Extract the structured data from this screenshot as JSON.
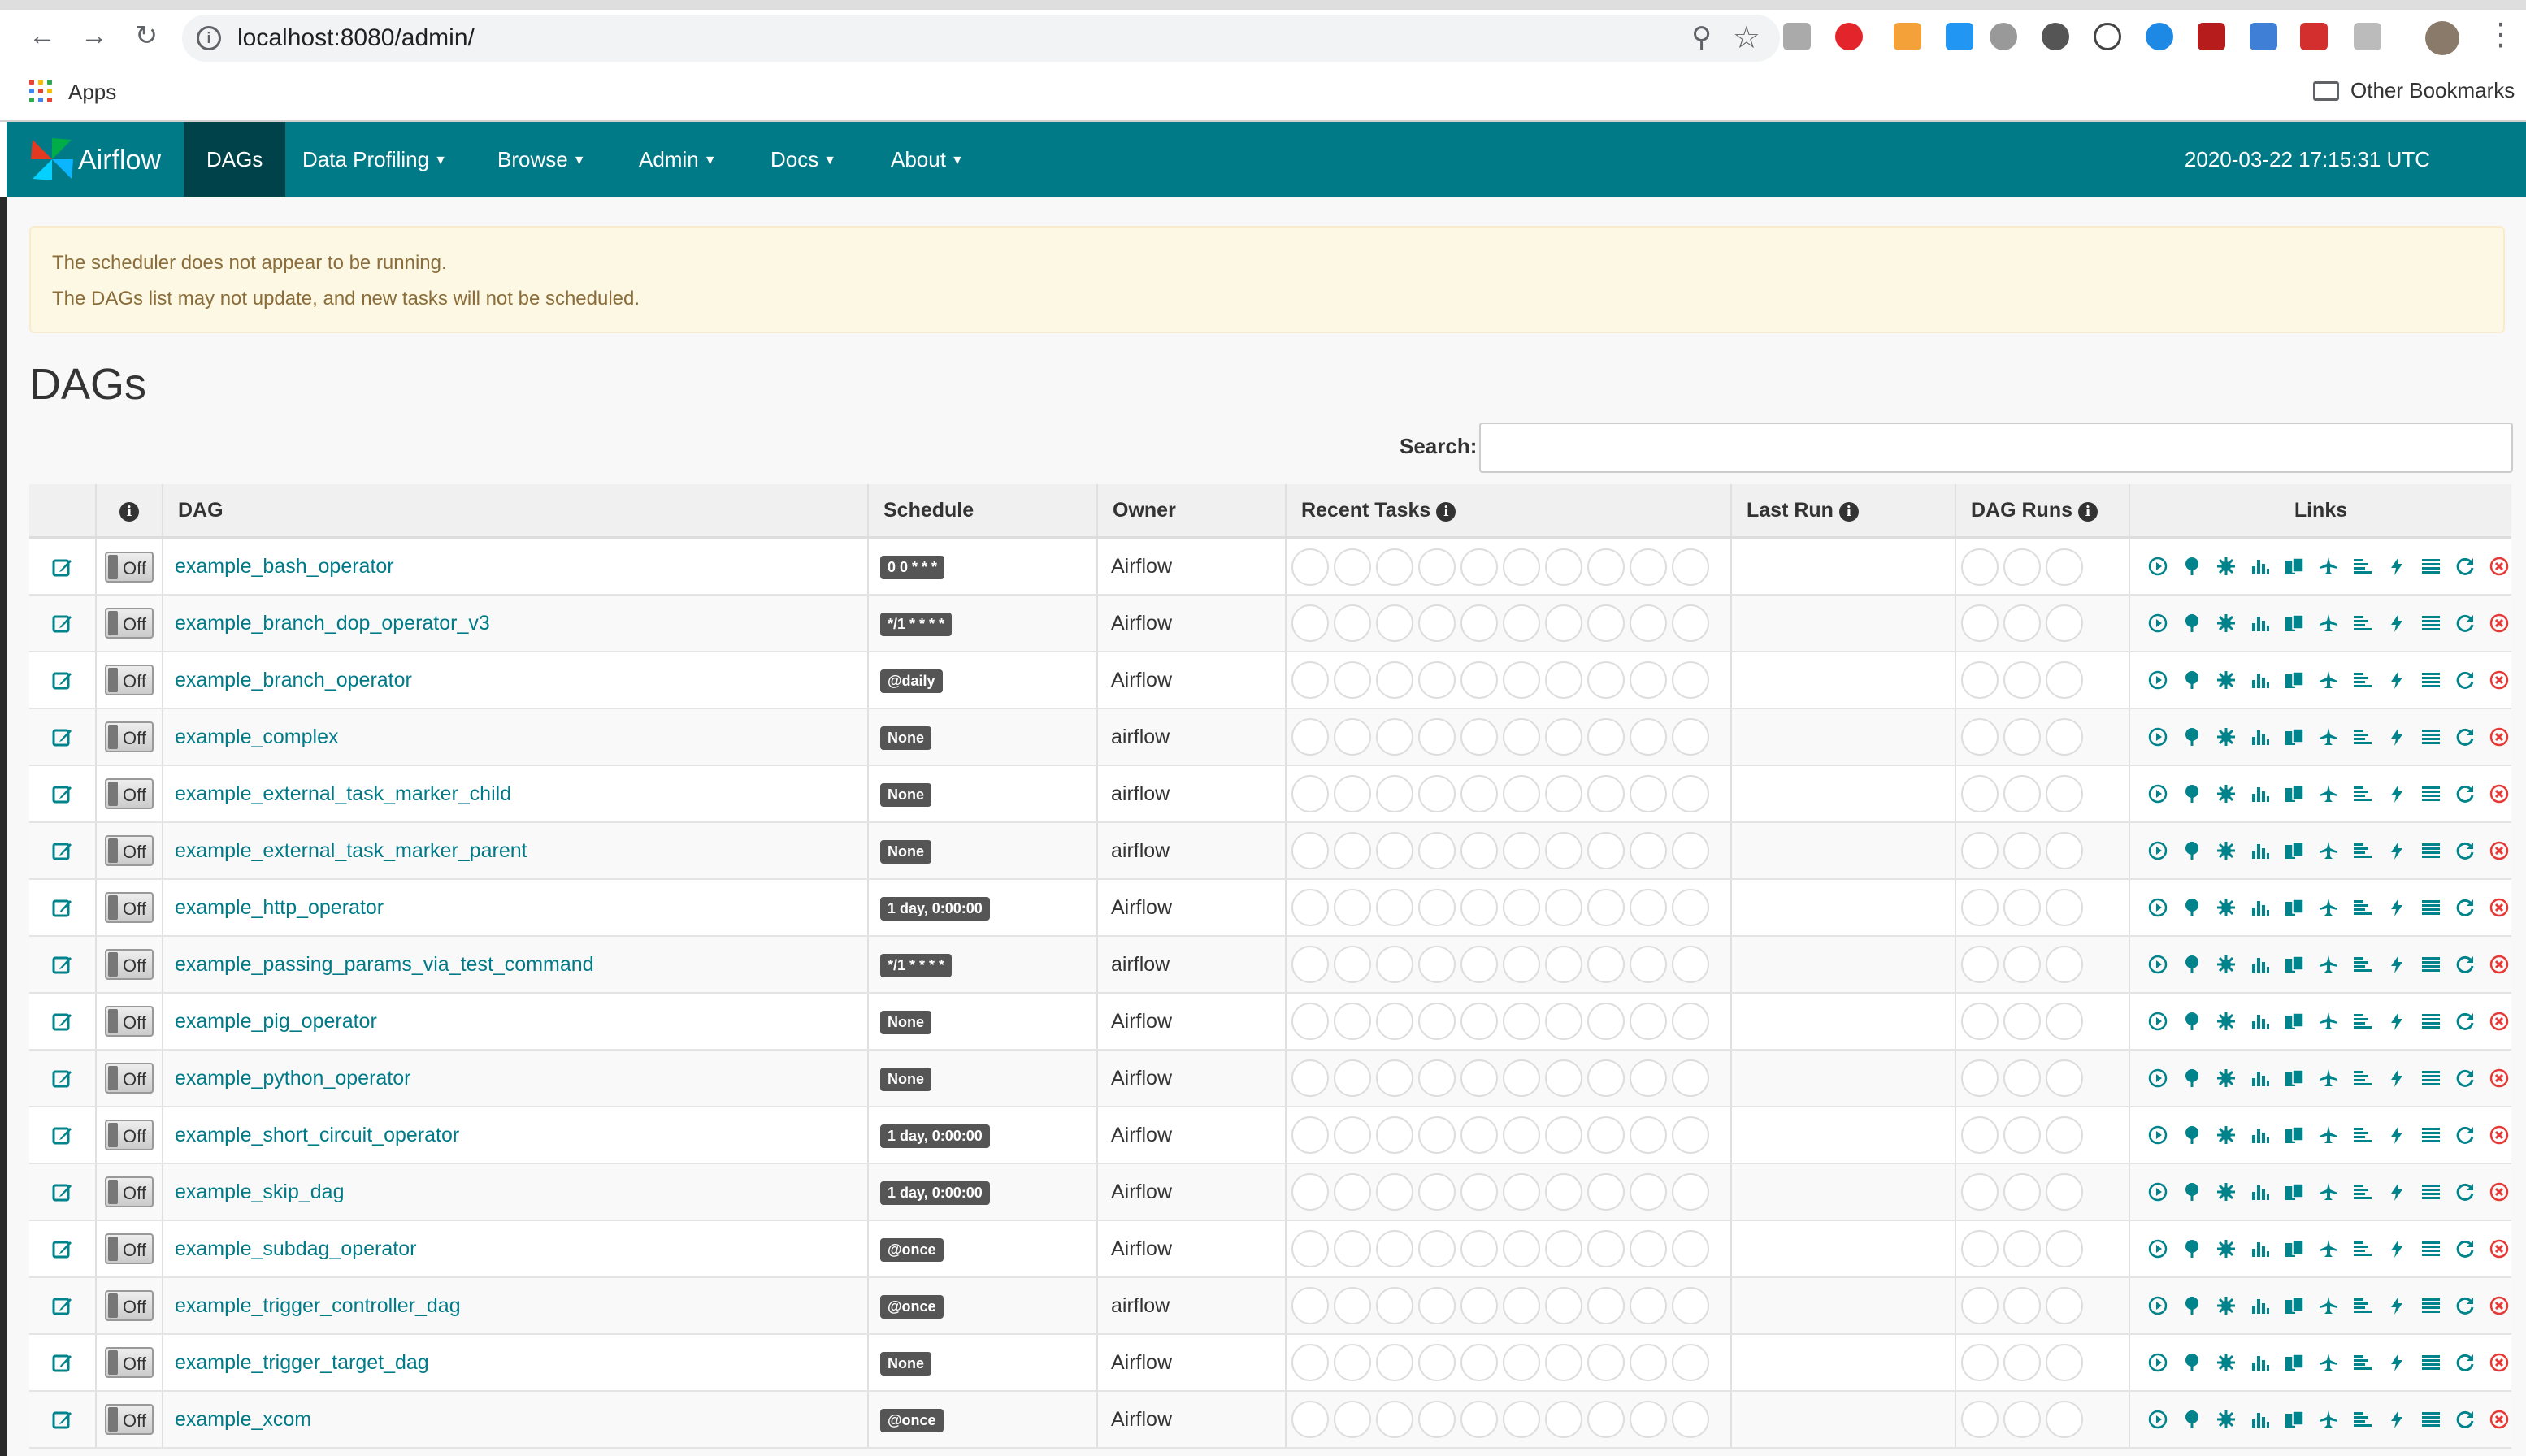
{
  "browser": {
    "url": "localhost:8080/admin/",
    "bookmarks": {
      "apps_label": "Apps",
      "other_label": "Other Bookmarks"
    }
  },
  "navbar": {
    "brand": "Airflow",
    "items": [
      {
        "label": "DAGs",
        "dropdown": false
      },
      {
        "label": "Data Profiling",
        "dropdown": true
      },
      {
        "label": "Browse",
        "dropdown": true
      },
      {
        "label": "Admin",
        "dropdown": true
      },
      {
        "label": "Docs",
        "dropdown": true
      },
      {
        "label": "About",
        "dropdown": true
      }
    ],
    "time": "2020-03-22 17:15:31 UTC"
  },
  "alert": {
    "line1": "The scheduler does not appear to be running.",
    "line2": "The DAGs list may not update, and new tasks will not be scheduled."
  },
  "page_title": "DAGs",
  "search": {
    "label": "Search:",
    "value": ""
  },
  "table": {
    "headers": [
      "",
      "",
      "DAG",
      "Schedule",
      "Owner",
      "Recent Tasks",
      "Last Run",
      "DAG Runs",
      "Links"
    ],
    "rows": [
      {
        "dag": "example_bash_operator",
        "schedule": "0 0 * * *",
        "owner": "Airflow",
        "toggle": "Off"
      },
      {
        "dag": "example_branch_dop_operator_v3",
        "schedule": "*/1 * * * *",
        "owner": "Airflow",
        "toggle": "Off"
      },
      {
        "dag": "example_branch_operator",
        "schedule": "@daily",
        "owner": "Airflow",
        "toggle": "Off"
      },
      {
        "dag": "example_complex",
        "schedule": "None",
        "owner": "airflow",
        "toggle": "Off"
      },
      {
        "dag": "example_external_task_marker_child",
        "schedule": "None",
        "owner": "airflow",
        "toggle": "Off"
      },
      {
        "dag": "example_external_task_marker_parent",
        "schedule": "None",
        "owner": "airflow",
        "toggle": "Off"
      },
      {
        "dag": "example_http_operator",
        "schedule": "1 day, 0:00:00",
        "owner": "Airflow",
        "toggle": "Off"
      },
      {
        "dag": "example_passing_params_via_test_command",
        "schedule": "*/1 * * * *",
        "owner": "airflow",
        "toggle": "Off"
      },
      {
        "dag": "example_pig_operator",
        "schedule": "None",
        "owner": "Airflow",
        "toggle": "Off"
      },
      {
        "dag": "example_python_operator",
        "schedule": "None",
        "owner": "Airflow",
        "toggle": "Off"
      },
      {
        "dag": "example_short_circuit_operator",
        "schedule": "1 day, 0:00:00",
        "owner": "Airflow",
        "toggle": "Off"
      },
      {
        "dag": "example_skip_dag",
        "schedule": "1 day, 0:00:00",
        "owner": "Airflow",
        "toggle": "Off"
      },
      {
        "dag": "example_subdag_operator",
        "schedule": "@once",
        "owner": "Airflow",
        "toggle": "Off"
      },
      {
        "dag": "example_trigger_controller_dag",
        "schedule": "@once",
        "owner": "airflow",
        "toggle": "Off"
      },
      {
        "dag": "example_trigger_target_dag",
        "schedule": "None",
        "owner": "Airflow",
        "toggle": "Off"
      },
      {
        "dag": "example_xcom",
        "schedule": "@once",
        "owner": "Airflow",
        "toggle": "Off"
      }
    ]
  },
  "colors": {
    "navbar": "#007a87",
    "active_nav": "#00424a",
    "link": "#007a87",
    "alert_bg": "#fcf8e3",
    "alert_text": "#8a6d3b"
  }
}
